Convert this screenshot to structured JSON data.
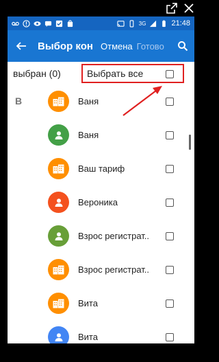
{
  "statusbar": {
    "network": "3G",
    "time": "21:48"
  },
  "appbar": {
    "title": "Выбор кон",
    "cancel_label": "Отмена",
    "done_label": "Готово"
  },
  "selection": {
    "count_label": "выбран (0)",
    "select_all_label": "Выбрать все"
  },
  "section_letter": "В",
  "contacts": [
    {
      "name": "Ваня",
      "avatar": "business-icon",
      "color": "#ff8f00",
      "checked": false
    },
    {
      "name": "Ваня",
      "avatar": "person-icon",
      "color": "#43a047",
      "checked": false
    },
    {
      "name": "Ваш тариф",
      "avatar": "business-icon",
      "color": "#ff8f00",
      "checked": false
    },
    {
      "name": "Вероника",
      "avatar": "person-icon",
      "color": "#f4511e",
      "checked": false
    },
    {
      "name": "Взрос регистрат..",
      "avatar": "person-icon",
      "color": "#689f38",
      "checked": false
    },
    {
      "name": "Взрос регистрат..",
      "avatar": "business-icon",
      "color": "#ff8f00",
      "checked": false
    },
    {
      "name": "Вита",
      "avatar": "business-icon",
      "color": "#ff8f00",
      "checked": false
    },
    {
      "name": "Вита",
      "avatar": "person-icon",
      "color": "#4285f4",
      "checked": false
    }
  ],
  "colors": {
    "statusbar": "#1565c0",
    "appbar": "#1976d2",
    "highlight": "#e02020"
  }
}
